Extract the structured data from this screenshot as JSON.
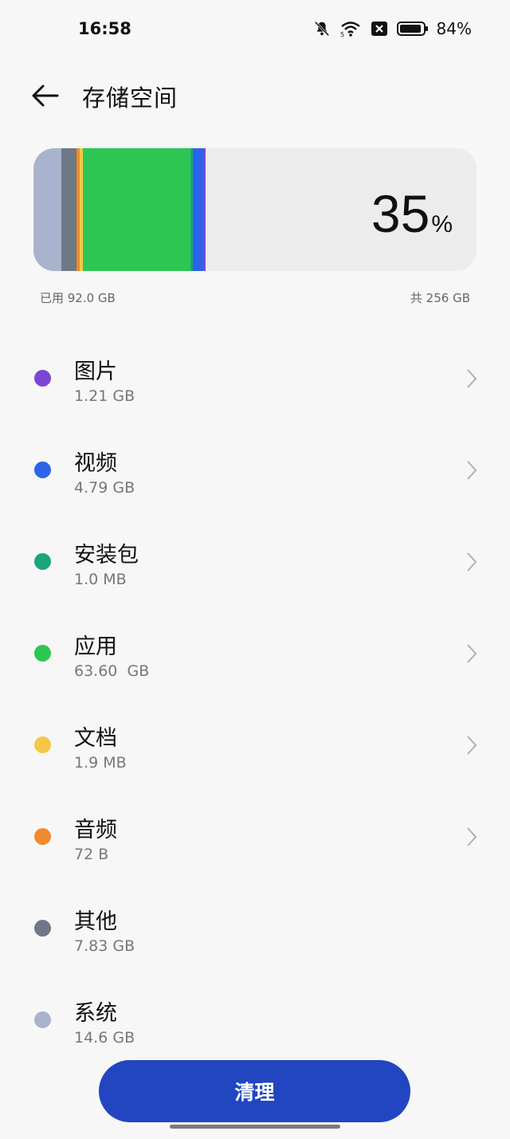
{
  "status": {
    "time": "16:58",
    "battery": "84%"
  },
  "header": {
    "title": "存储空间"
  },
  "storage": {
    "percent": "35",
    "percent_unit": "%",
    "used_label": "已用 92.0 GB",
    "total_label": "共 256 GB",
    "bar_segments": [
      {
        "name": "系统",
        "fraction": 0.063,
        "color": "#a9b3cd"
      },
      {
        "name": "其他",
        "fraction": 0.034,
        "color": "#6f7887"
      },
      {
        "name": "音频",
        "fraction": 0.007,
        "color": "#f08a2b"
      },
      {
        "name": "文档",
        "fraction": 0.007,
        "color": "#f6c744"
      },
      {
        "name": "应用",
        "fraction": 0.243,
        "color": "#2dc653"
      },
      {
        "name": "安装包",
        "fraction": 0.005,
        "color": "#1aa57a"
      },
      {
        "name": "视频",
        "fraction": 0.024,
        "color": "#2c63ea"
      },
      {
        "name": "图片",
        "fraction": 0.006,
        "color": "#7b45d6"
      }
    ]
  },
  "items": [
    {
      "name": "图片",
      "size": "1.21 GB",
      "color": "#7b45d6",
      "has_chevron": true
    },
    {
      "name": "视频",
      "size": "4.79 GB",
      "color": "#2c63ea",
      "has_chevron": true
    },
    {
      "name": "安装包",
      "size": "1.0 MB",
      "color": "#1aa57a",
      "has_chevron": true
    },
    {
      "name": "应用",
      "size": "63.60  GB",
      "color": "#2dc653",
      "has_chevron": true
    },
    {
      "name": "文档",
      "size": "1.9 MB",
      "color": "#f6c744",
      "has_chevron": true
    },
    {
      "name": "音频",
      "size": "72 B",
      "color": "#f08a2b",
      "has_chevron": true
    },
    {
      "name": "其他",
      "size": "7.83 GB",
      "color": "#6f7887",
      "has_chevron": false
    },
    {
      "name": "系统",
      "size": "14.6 GB",
      "color": "#a9b3cd",
      "has_chevron": false
    }
  ],
  "actions": {
    "clean_label": "清理"
  },
  "icons": {
    "status": [
      "bell-off-icon",
      "wifi-icon",
      "sim-off-icon",
      "battery-icon"
    ],
    "back": "arrow-left-icon",
    "chevron": "chevron-right-icon"
  }
}
